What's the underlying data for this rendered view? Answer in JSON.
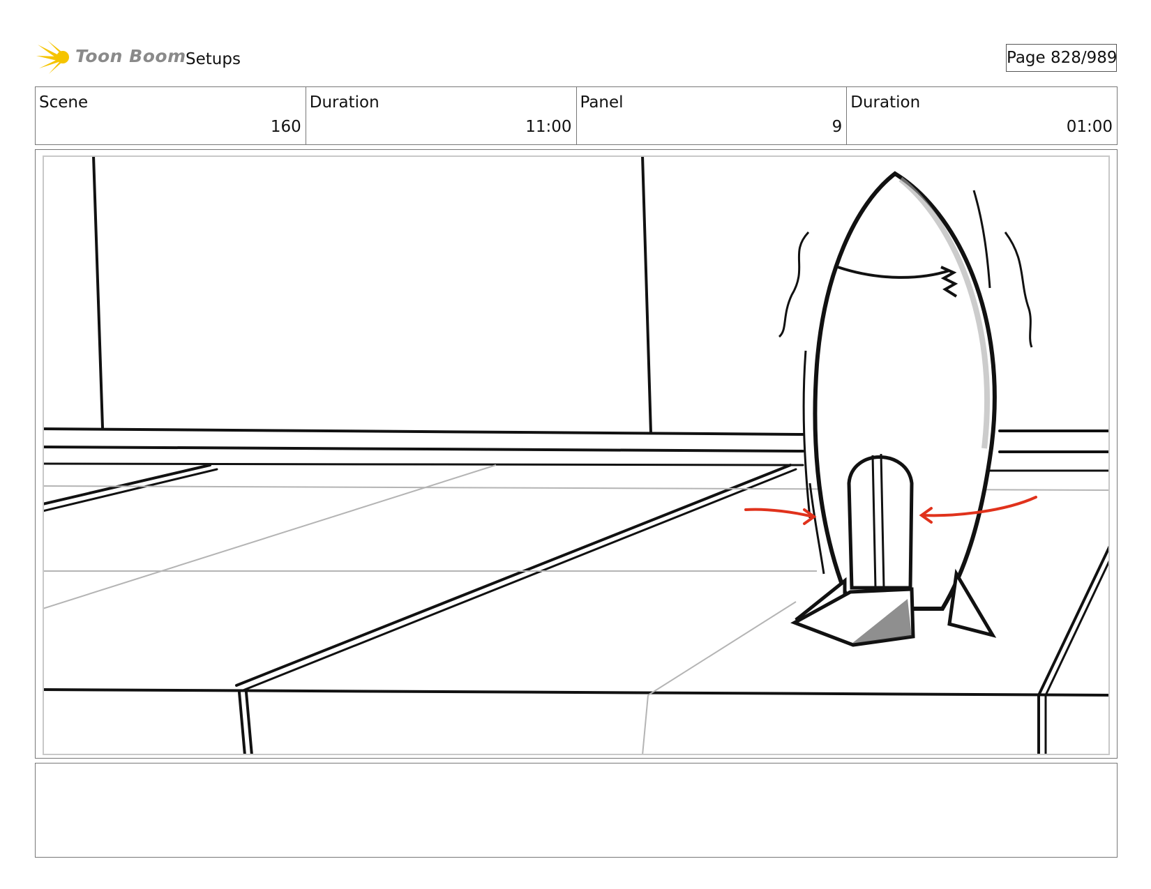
{
  "header": {
    "logo_text": "Toon Boom",
    "section_title": "Setups",
    "page_indicator": "Page 828/989"
  },
  "info_bar": {
    "scene_label": "Scene",
    "scene_value": "160",
    "scene_duration_label": "Duration",
    "scene_duration_value": "11:00",
    "panel_label": "Panel",
    "panel_value": "9",
    "panel_duration_label": "Duration",
    "panel_duration_value": "01:00"
  },
  "colors": {
    "logo_accent": "#f5c400",
    "arrow_red": "#e0321c"
  },
  "notes": {
    "text": ""
  }
}
